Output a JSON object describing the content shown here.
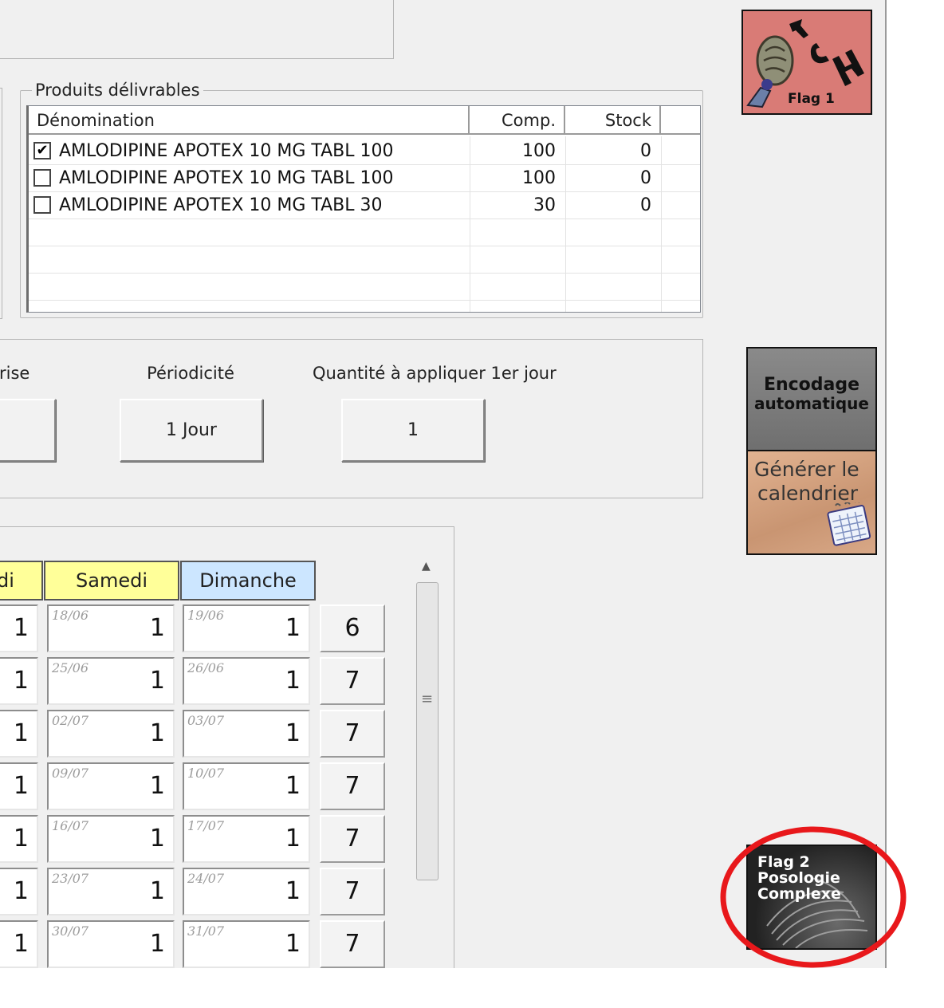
{
  "products": {
    "legend": "Produits délivrables",
    "columns": [
      "Dénomination",
      "Comp.",
      "Stock"
    ],
    "rows": [
      {
        "checked": true,
        "name": "AMLODIPINE APOTEX 10 MG TABL 100",
        "comp": "100",
        "stock": "0"
      },
      {
        "checked": false,
        "name": "AMLODIPINE APOTEX 10 MG TABL 100",
        "comp": "100",
        "stock": "0"
      },
      {
        "checked": false,
        "name": "AMLODIPINE APOTEX 10 MG TABL 30",
        "comp": "30",
        "stock": "0"
      }
    ]
  },
  "dosage": {
    "prise_label": "rise",
    "periodicite_label": "Périodicité",
    "periodicite_value": "1 Jour",
    "quantite_label": "Quantité à appliquer 1er jour",
    "quantite_value": "1"
  },
  "calendar": {
    "days": [
      "di",
      "Samedi",
      "Dimanche"
    ],
    "weeks": [
      {
        "left": "1",
        "sat_date": "18/06",
        "sat": "1",
        "sun_date": "19/06",
        "sun": "1",
        "total": "6"
      },
      {
        "left": "1",
        "sat_date": "25/06",
        "sat": "1",
        "sun_date": "26/06",
        "sun": "1",
        "total": "7"
      },
      {
        "left": "1",
        "sat_date": "02/07",
        "sat": "1",
        "sun_date": "03/07",
        "sun": "1",
        "total": "7"
      },
      {
        "left": "1",
        "sat_date": "09/07",
        "sat": "1",
        "sun_date": "10/07",
        "sun": "1",
        "total": "7"
      },
      {
        "left": "1",
        "sat_date": "16/07",
        "sat": "1",
        "sun_date": "17/07",
        "sun": "1",
        "total": "7"
      },
      {
        "left": "1",
        "sat_date": "23/07",
        "sat": "1",
        "sun_date": "24/07",
        "sun": "1",
        "total": "7"
      },
      {
        "left": "1",
        "sat_date": "30/07",
        "sat": "1",
        "sun_date": "31/07",
        "sun": "1",
        "total": "7"
      }
    ]
  },
  "tiles": {
    "tch_logo": "TCH",
    "flag1": "Flag 1",
    "encodage_line1": "Encodage",
    "encodage_line2": "automatique",
    "generer_line1": "Générer le",
    "generer_line2": "calendrier",
    "flag2_line1": "Flag 2",
    "flag2_line2": "Posologie",
    "flag2_line3": "Complexe"
  },
  "colors": {
    "saturday_header": "#ffff99",
    "sunday_header": "#cce6ff",
    "flag1_bg": "#d97b76",
    "encodage_bg": "#7d7d7d",
    "generer_bg": "#d9a784",
    "flag2_bg": "#222222",
    "annotation_circle": "#e8181b"
  }
}
